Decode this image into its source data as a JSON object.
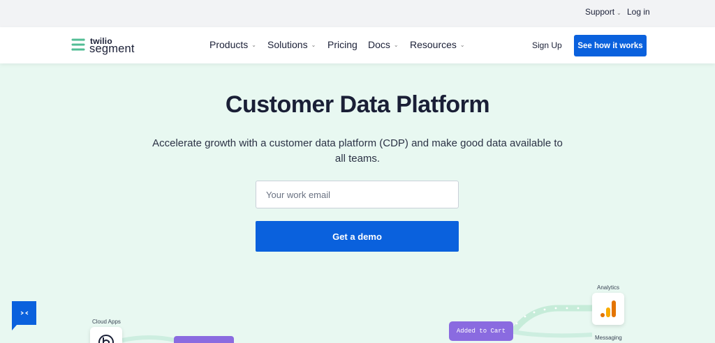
{
  "utility": {
    "support_label": "Support",
    "login_label": "Log in"
  },
  "brand": {
    "top": "twilio",
    "bottom": "segment",
    "accent_color": "#52bd94"
  },
  "nav": {
    "items": [
      {
        "label": "Products",
        "has_dropdown": true
      },
      {
        "label": "Solutions",
        "has_dropdown": true
      },
      {
        "label": "Pricing",
        "has_dropdown": false
      },
      {
        "label": "Docs",
        "has_dropdown": true
      },
      {
        "label": "Resources",
        "has_dropdown": true
      }
    ],
    "signup_label": "Sign Up",
    "cta_label": "See how it works",
    "cta_color": "#0a61dd"
  },
  "hero": {
    "title": "Customer Data Platform",
    "subtitle": "Accelerate growth with a customer data platform (CDP) and make good data available to all teams.",
    "email_placeholder": "Your work email",
    "email_value": "",
    "demo_label": "Get a demo"
  },
  "diagram": {
    "cloud_apps_label": "Cloud Apps",
    "analytics_label": "Analytics",
    "messaging_label": "Messaging",
    "event_label": "Added to Cart",
    "event_color": "#8a6be0"
  },
  "icons": {
    "logo": "segment-logo-icon",
    "chevron": "chevron-down-icon",
    "chat": "chat-icon",
    "cloud_app": "cloud-app-icon",
    "analytics": "google-analytics-icon"
  }
}
